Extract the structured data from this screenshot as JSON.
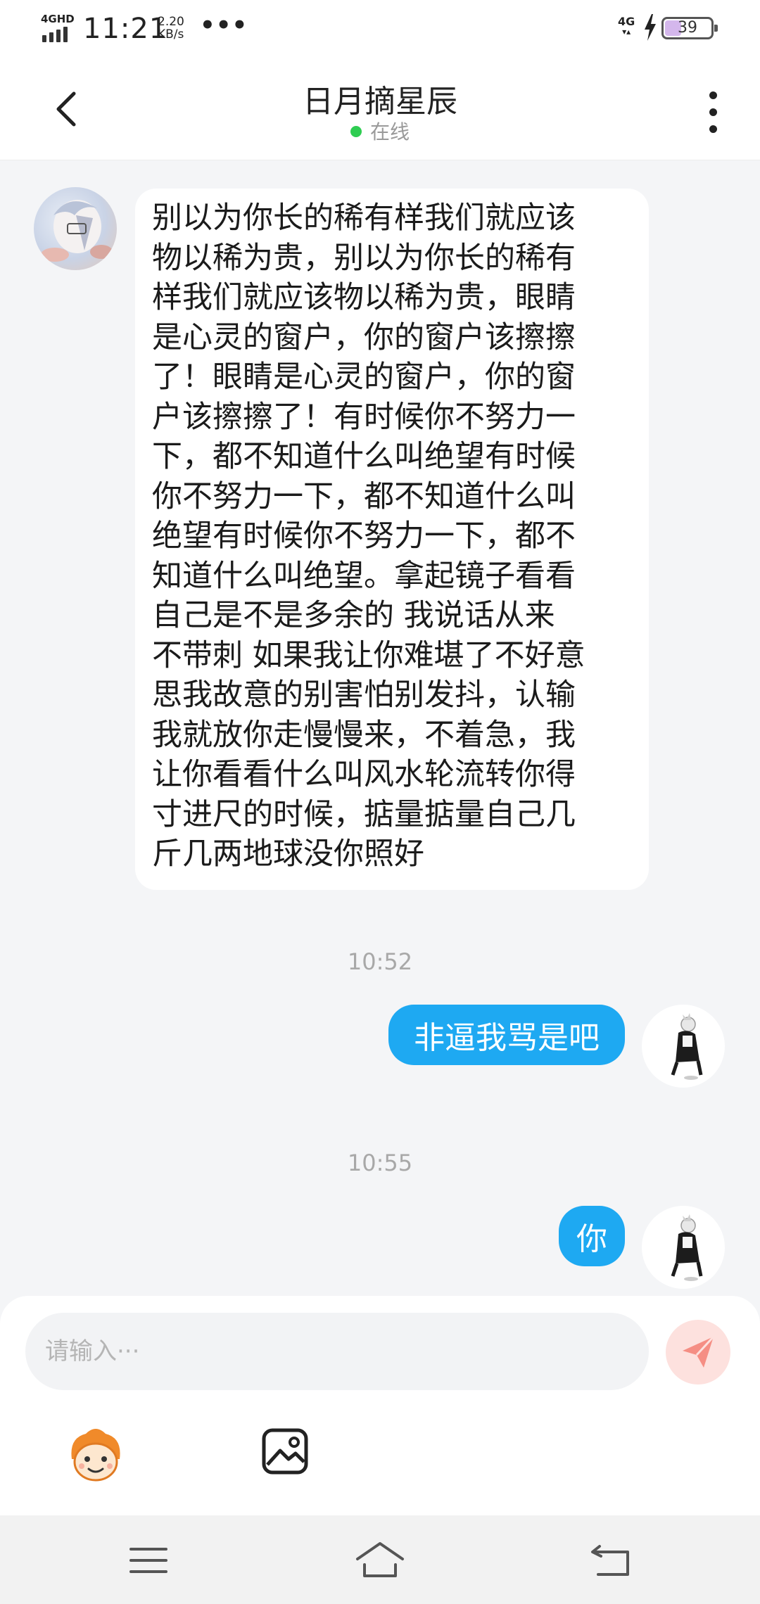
{
  "status_bar": {
    "network_type": "4GHD",
    "time": "11:21",
    "speed_value": "2.20",
    "speed_unit": "KB/s",
    "more": "•••",
    "right_network": "4G",
    "battery": "39",
    "battery_level": 0.39
  },
  "header": {
    "title": "日月摘星辰",
    "status": "在线",
    "status_color": "#2fcd52"
  },
  "messages": [
    {
      "direction": "incoming",
      "text": "别以为你长的稀有样我们就应该\n物以稀为贵，别以为你长的稀有\n样我们就应该物以稀为贵，眼睛\n是心灵的窗户，你的窗户该擦擦\n了！眼睛是心灵的窗户，你的窗\n户该擦擦了！有时候你不努力一\n下，都不知道什么叫绝望有时候\n你不努力一下，都不知道什么叫\n绝望有时候你不努力一下，都不\n知道什么叫绝望。拿起镜子看看\n自己是不是多余的  我说话从来\n不带刺 如果我让你难堪了不好意\n思我故意的别害怕别发抖，认输\n我就放你走慢慢来，不着急，我\n让你看看什么叫风水轮流转你得\n寸进尺的时候，掂量掂量自己几\n斤几两地球没你照好"
    },
    {
      "time": "10:52"
    },
    {
      "direction": "outgoing",
      "text": "非逼我骂是吧"
    },
    {
      "time": "10:55"
    },
    {
      "direction": "outgoing",
      "text": "你"
    }
  ],
  "input": {
    "placeholder": "请输入···"
  },
  "colors": {
    "outgoing_bubble": "#1ea9f2",
    "send_button_bg": "#fde1de",
    "send_button_icon": "#f58e84"
  },
  "icons": {
    "back": "chevron-left-icon",
    "more": "more-vertical-icon",
    "send": "send-icon",
    "emoji": "emoji-face-icon",
    "image": "image-icon",
    "nav_menu": "menu-icon",
    "nav_home": "home-icon",
    "nav_back": "back-icon"
  }
}
